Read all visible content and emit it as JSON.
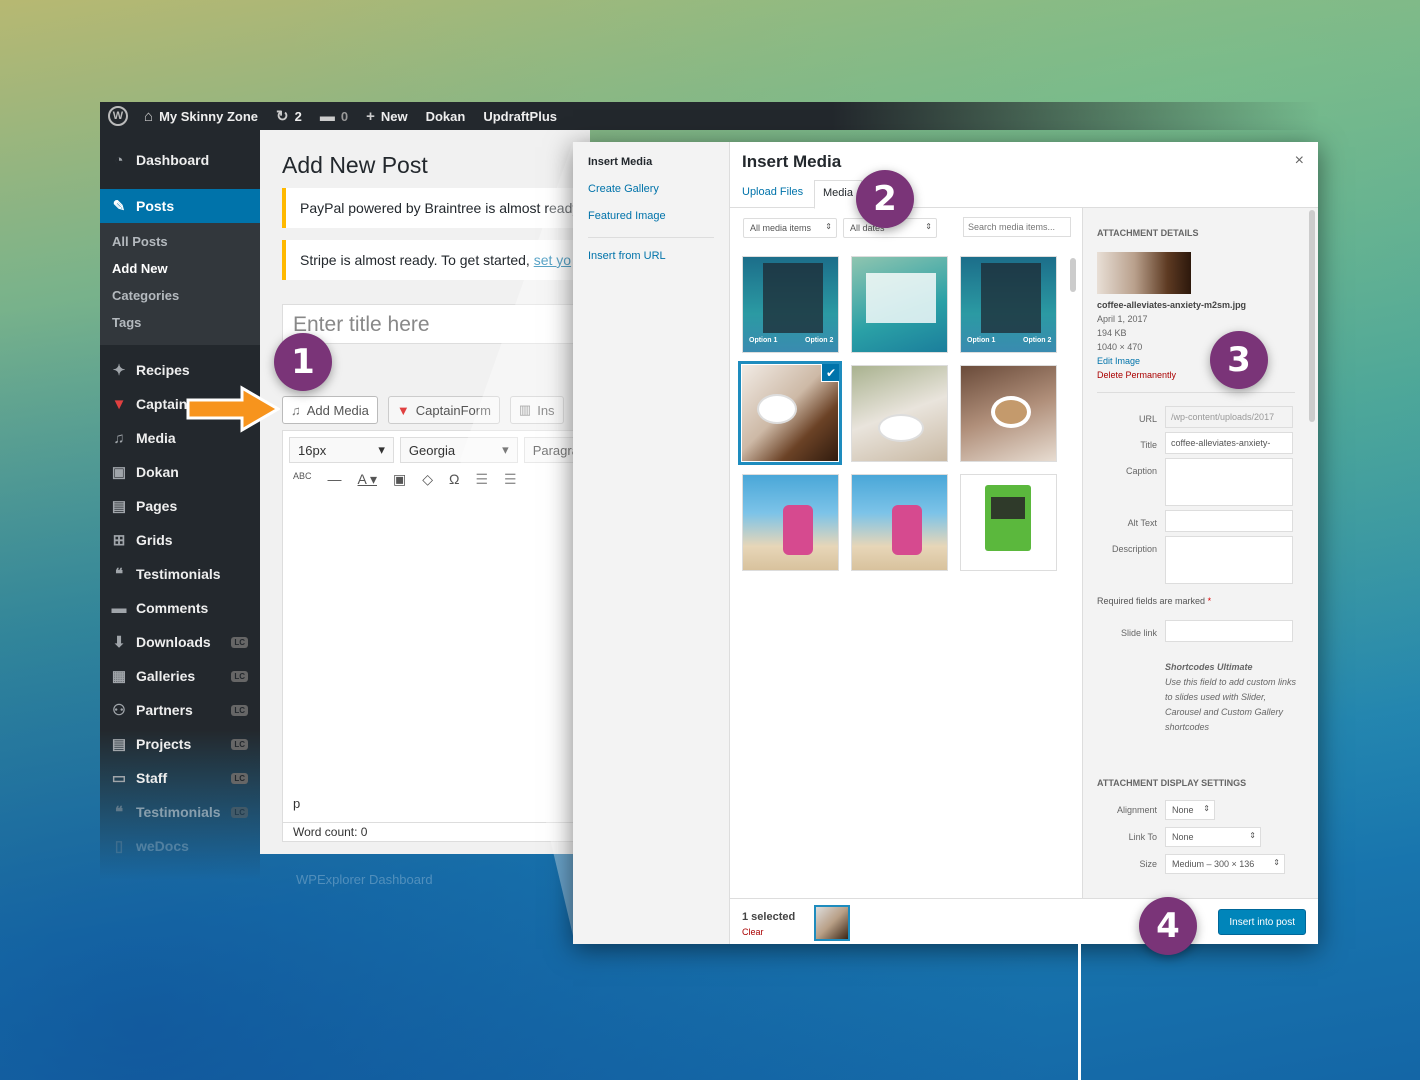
{
  "adminbar": {
    "site_name": "My Skinny Zone",
    "updates_count": "2",
    "comments_count": "0",
    "new_label": "New",
    "dokan_label": "Dokan",
    "updraft_label": "UpdraftPlus"
  },
  "sidebar": {
    "dashboard": "Dashboard",
    "posts": "Posts",
    "submenu": [
      "All Posts",
      "Add New",
      "Categories",
      "Tags"
    ],
    "items": [
      {
        "label": "Recipes",
        "icon": "recipes-icon"
      },
      {
        "label": "CaptainForm",
        "icon": "captainform-icon"
      },
      {
        "label": "Media",
        "icon": "media-icon"
      },
      {
        "label": "Dokan",
        "icon": "dokan-icon"
      },
      {
        "label": "Pages",
        "icon": "pages-icon"
      },
      {
        "label": "Grids",
        "icon": "grid-icon"
      },
      {
        "label": "Testimonials",
        "icon": "quote-icon"
      },
      {
        "label": "Comments",
        "icon": "comment-icon"
      },
      {
        "label": "Downloads",
        "icon": "download-icon",
        "badge": "LC"
      },
      {
        "label": "Galleries",
        "icon": "gallery-icon",
        "badge": "LC"
      },
      {
        "label": "Partners",
        "icon": "partners-icon",
        "badge": "LC"
      },
      {
        "label": "Projects",
        "icon": "projects-icon",
        "badge": "LC"
      },
      {
        "label": "Staff",
        "icon": "staff-icon",
        "badge": "LC"
      },
      {
        "label": "Testimonials",
        "icon": "quote-icon",
        "badge": "LC"
      },
      {
        "label": "weDocs",
        "icon": "docs-icon"
      }
    ],
    "footer_ghost": "WPExplorer Dashboard"
  },
  "editor": {
    "page_title": "Add New Post",
    "notice_paypal": "PayPal powered by Braintree is almost ready",
    "notice_stripe": "Stripe is almost ready. To get started, ",
    "notice_stripe_link": "set yo",
    "title_placeholder": "Enter title here",
    "add_media": "Add Media",
    "captainform": "CaptainForm",
    "ins": "Ins",
    "font_size": "16px",
    "font_family": "Georgia",
    "format": "Paragra",
    "path": "p",
    "word_count": "Word count: 0"
  },
  "modal": {
    "menu": {
      "insert_media": "Insert Media",
      "create_gallery": "Create Gallery",
      "featured_image": "Featured Image",
      "insert_from_url": "Insert from URL"
    },
    "title": "Insert Media",
    "close": "×",
    "tabs": {
      "upload": "Upload Files",
      "library": "Media"
    },
    "filter_type": "All media items",
    "filter_date": "All dates",
    "search_placeholder": "Search media items...",
    "tile_labels": {
      "opt1": "Option 1",
      "opt2": "Option 2"
    },
    "details": {
      "heading": "ATTACHMENT DETAILS",
      "filename": "coffee-alleviates-anxiety-m2sm.jpg",
      "date": "April 1, 2017",
      "size": "194 KB",
      "dimensions": "1040 × 470",
      "edit_image": "Edit Image",
      "delete": "Delete Permanently",
      "url_label": "URL",
      "url_value": "/wp-content/uploads/2017",
      "title_label": "Title",
      "title_value": "coffee-alleviates-anxiety-",
      "caption_label": "Caption",
      "alt_label": "Alt Text",
      "description_label": "Description",
      "required_note": "Required fields are marked",
      "required_star": "*",
      "slide_link_label": "Slide link",
      "help_title": "Shortcodes Ultimate",
      "help_text": "Use this field to add custom links to slides used with Slider, Carousel and Custom Gallery shortcodes",
      "display_heading": "ATTACHMENT DISPLAY SETTINGS",
      "alignment_label": "Alignment",
      "alignment_value": "None",
      "link_to_label": "Link To",
      "link_to_value": "None",
      "size_label": "Size",
      "size_value": "Medium – 300 × 136"
    },
    "toolbar": {
      "selected": "1 selected",
      "clear": "Clear",
      "insert": "Insert into post"
    }
  },
  "steps": [
    "1",
    "2",
    "3",
    "4"
  ],
  "colors": {
    "wp_blue": "#0073aa",
    "badge_purple": "#7a3478",
    "arrow_orange": "#f7941d"
  }
}
